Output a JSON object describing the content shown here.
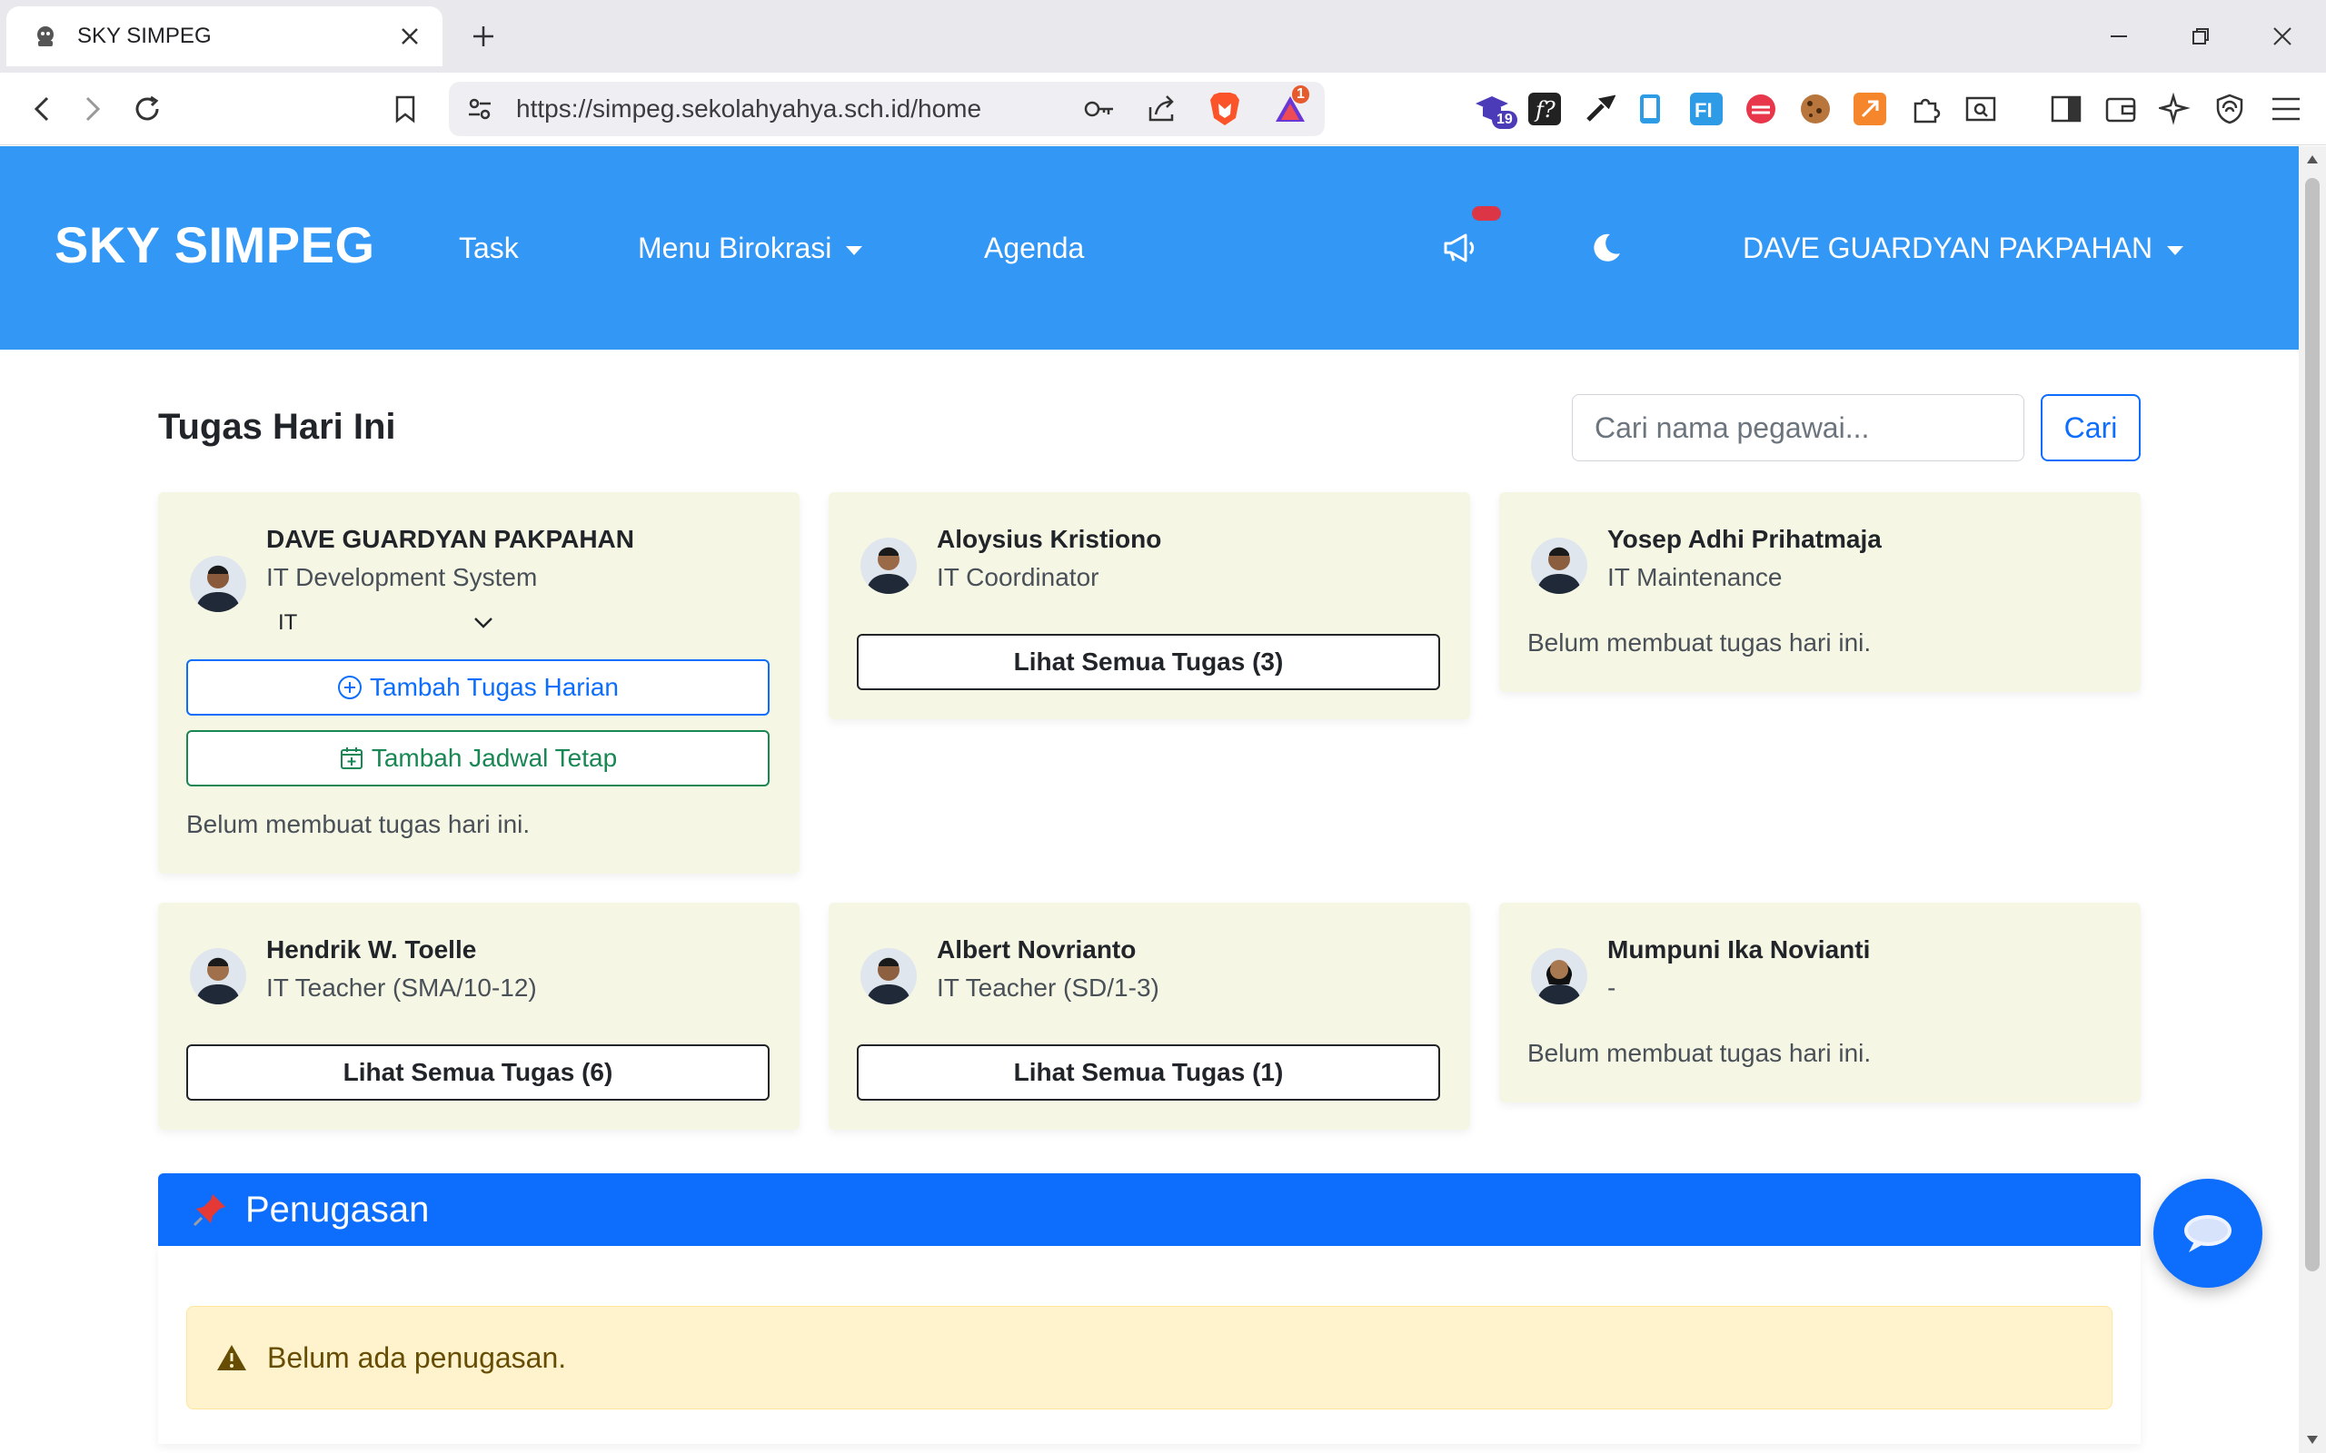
{
  "browser": {
    "tab_title": "SKY SIMPEG",
    "url": "https://simpeg.sekolahyahya.sch.id/home",
    "ext_badge_count": "19",
    "brave_rewards_count": "1"
  },
  "navbar": {
    "brand": "SKY SIMPEG",
    "task_label": "Task",
    "birokrasi_label": "Menu Birokrasi",
    "agenda_label": "Agenda",
    "user_name": "DAVE GUARDYAN PAKPAHAN"
  },
  "main": {
    "title": "Tugas Hari Ini",
    "search_placeholder": "Cari nama pegawai...",
    "search_button": "Cari"
  },
  "employees": [
    {
      "name": "DAVE GUARDYAN PAKPAHAN",
      "role": "IT Development System",
      "department": "IT",
      "add_task_label": "Tambah Tugas Harian",
      "add_schedule_label": "Tambah Jadwal Tetap",
      "status": "Belum membuat tugas hari ini."
    },
    {
      "name": "Aloysius Kristiono",
      "role": "IT Coordinator",
      "view_tasks_label": "Lihat Semua Tugas (3)"
    },
    {
      "name": "Yosep Adhi Prihatmaja",
      "role": "IT Maintenance",
      "status": "Belum membuat tugas hari ini."
    },
    {
      "name": "Hendrik W. Toelle",
      "role": "IT Teacher (SMA/10-12)",
      "view_tasks_label": "Lihat Semua Tugas (6)"
    },
    {
      "name": "Albert Novrianto",
      "role": "IT Teacher (SD/1-3)",
      "view_tasks_label": "Lihat Semua Tugas (1)"
    },
    {
      "name": "Mumpuni Ika Novianti",
      "role": "-",
      "status": "Belum membuat tugas hari ini."
    }
  ],
  "penugasan": {
    "title": "Penugasan",
    "alert_text": "Belum ada penugasan."
  },
  "colors": {
    "navbar": "#3397f5",
    "primary": "#0d6efd",
    "card_bg": "#f5f7e4",
    "alert_bg": "#fff3cd"
  }
}
